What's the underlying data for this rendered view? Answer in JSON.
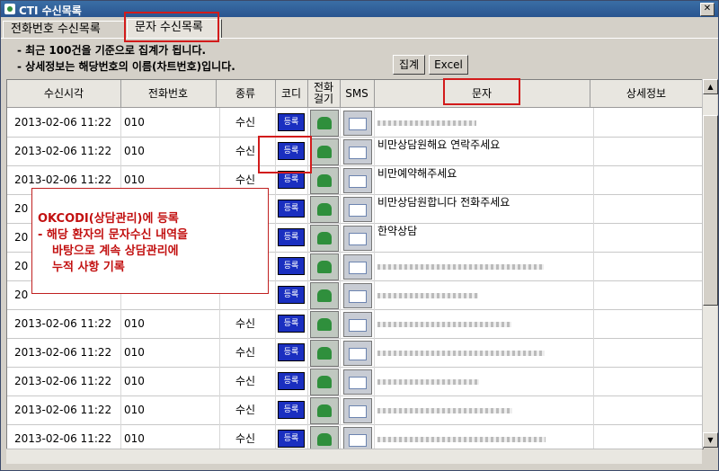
{
  "window": {
    "title": "CTI 수신목록"
  },
  "tabs": [
    "전화번호 수신목록",
    "문자 수신목록"
  ],
  "info": [
    "- 최근 100건을 기준으로 집계가 됩니다.",
    "- 상세정보는 해당번호의 이름(차트번호)입니다."
  ],
  "buttons": {
    "aggregate": "집계",
    "excel": "Excel"
  },
  "columns": {
    "time": "수신시각",
    "phone": "전화번호",
    "type": "종류",
    "code": "코디",
    "call": "전화\n걸기",
    "sms": "SMS",
    "message": "문자",
    "detail": "상세정보"
  },
  "cell_labels": {
    "register": "등록"
  },
  "rows": [
    {
      "time": "2013-02-06  11:22",
      "phone": "010",
      "type": "수신",
      "message": ""
    },
    {
      "time": "2013-02-06  11:22",
      "phone": "010",
      "type": "수신",
      "message": "비만상담원해요 연락주세요"
    },
    {
      "time": "2013-02-06  11:22",
      "phone": "010",
      "type": "수신",
      "message": "비만예약해주세요"
    },
    {
      "time": "20",
      "phone": "",
      "type": "",
      "message": "비만상담원합니다 전화주세요"
    },
    {
      "time": "20",
      "phone": "",
      "type": "",
      "message": "한약상담"
    },
    {
      "time": "20",
      "phone": "",
      "type": "",
      "message": ""
    },
    {
      "time": "20",
      "phone": "",
      "type": "",
      "message": ""
    },
    {
      "time": "2013-02-06  11:22",
      "phone": "010",
      "type": "수신",
      "message": ""
    },
    {
      "time": "2013-02-06  11:22",
      "phone": "010",
      "type": "수신",
      "message": ""
    },
    {
      "time": "2013-02-06  11:22",
      "phone": "010",
      "type": "수신",
      "message": ""
    },
    {
      "time": "2013-02-06  11:22",
      "phone": "010",
      "type": "수신",
      "message": ""
    },
    {
      "time": "2013-02-06  11:22",
      "phone": "010",
      "type": "수신",
      "message": ""
    }
  ],
  "annotation": {
    "line1": "OKCODI(상담관리)에 등록",
    "line2": "- 해당 환자의 문자수신 내역을",
    "line3": "바탕으로 계속 상담관리에",
    "line4": "누적 사항 기록"
  },
  "colors": {
    "titlebar": "#2a5590",
    "highlight": "#d21b1b",
    "register_button": "#1a2fc0"
  }
}
